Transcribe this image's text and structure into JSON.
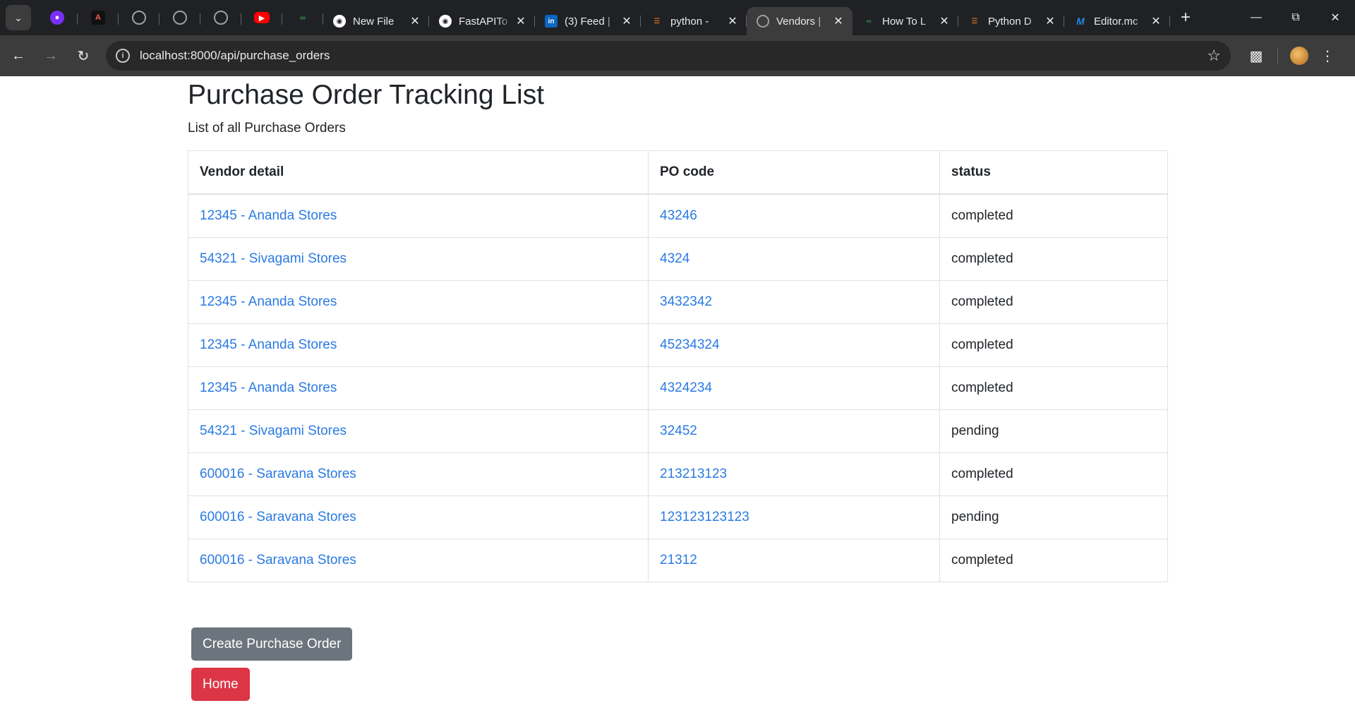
{
  "browser": {
    "tabs": [
      {
        "title": "New File",
        "favicon": "github-icon",
        "color": "#ffffff"
      },
      {
        "title": "FastAPITo",
        "favicon": "github-icon",
        "color": "#ffffff"
      },
      {
        "title": "(3) Feed |",
        "favicon": "linkedin-icon",
        "color": "#0a66c2"
      },
      {
        "title": "python -",
        "favicon": "stackoverflow-icon",
        "color": "#f48024"
      },
      {
        "title": "Vendors |",
        "favicon": "globe-icon",
        "color": "#9aa0a6",
        "active": true
      },
      {
        "title": "How To L",
        "favicon": "geeksforgeeks-icon",
        "color": "#2f8d46"
      },
      {
        "title": "Python D",
        "favicon": "stackoverflow-icon",
        "color": "#f48024"
      },
      {
        "title": "Editor.mc",
        "favicon": "markdown-editor-icon",
        "color": "#1e88e5"
      }
    ],
    "address_bar": {
      "url": "localhost:8000/api/purchase_orders"
    }
  },
  "page": {
    "title": "Purchase Order Tracking List",
    "subtitle": "List of all Purchase Orders",
    "table": {
      "headers": [
        "Vendor detail",
        "PO code",
        "status"
      ],
      "rows": [
        {
          "vendor": "12345 - Ananda Stores",
          "po_code": "43246",
          "status": "completed"
        },
        {
          "vendor": "54321 - Sivagami Stores",
          "po_code": "4324",
          "status": "completed"
        },
        {
          "vendor": "12345 - Ananda Stores",
          "po_code": "3432342",
          "status": "completed"
        },
        {
          "vendor": "12345 - Ananda Stores",
          "po_code": "45234324",
          "status": "completed"
        },
        {
          "vendor": "12345 - Ananda Stores",
          "po_code": "4324234",
          "status": "completed"
        },
        {
          "vendor": "54321 - Sivagami Stores",
          "po_code": "32452",
          "status": "pending"
        },
        {
          "vendor": "600016 - Saravana Stores",
          "po_code": "213213123",
          "status": "completed"
        },
        {
          "vendor": "600016 - Saravana Stores",
          "po_code": "123123123123",
          "status": "pending"
        },
        {
          "vendor": "600016 - Saravana Stores",
          "po_code": "21312",
          "status": "completed"
        }
      ]
    },
    "buttons": {
      "create_label": "Create Purchase Order",
      "home_label": "Home"
    }
  },
  "colors": {
    "link": "#2a7ae2",
    "secondary_button": "#6c757d",
    "danger_button": "#dc3545",
    "chrome_dark": "#202124",
    "chrome_toolbar": "#3c3c3c"
  }
}
